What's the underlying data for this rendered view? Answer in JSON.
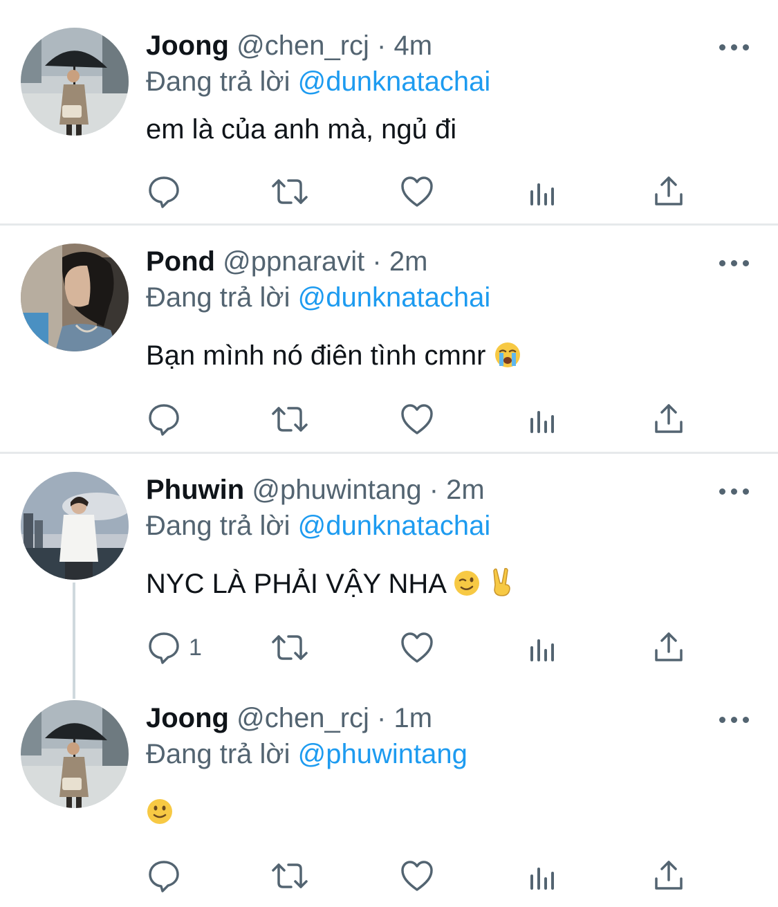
{
  "tweets": [
    {
      "name": "Joong",
      "handle": "@chen_rcj",
      "time": "4m",
      "reply_prefix": "Đang trả lời",
      "reply_to": "@dunknatachai",
      "text": "em là của anh mà, ngủ đi",
      "reply_count": "",
      "avatar_icon": "avatar-man-with-umbrella"
    },
    {
      "name": "Pond",
      "handle": "@ppnaravit",
      "time": "2m",
      "reply_prefix": "Đang trả lời",
      "reply_to": "@dunknatachai",
      "text": "Bạn mình nó điên tình cmnr",
      "emojis": [
        "loudly-crying-face"
      ],
      "reply_count": "",
      "avatar_icon": "avatar-side-profile"
    },
    {
      "name": "Phuwin",
      "handle": "@phuwintang",
      "time": "2m",
      "reply_prefix": "Đang trả lời",
      "reply_to": "@dunknatachai",
      "text": "NYC LÀ PHẢI VẬY NHA",
      "emojis": [
        "winking-face",
        "victory-hand"
      ],
      "reply_count": "1",
      "avatar_icon": "avatar-city-sky"
    },
    {
      "name": "Joong",
      "handle": "@chen_rcj",
      "time": "1m",
      "reply_prefix": "Đang trả lời",
      "reply_to": "@phuwintang",
      "text": "",
      "emojis": [
        "slightly-smiling-face"
      ],
      "reply_count": "",
      "avatar_icon": "avatar-man-with-umbrella"
    }
  ],
  "separator": "·",
  "action_icons": [
    "reply-icon",
    "retweet-icon",
    "like-icon",
    "analytics-icon",
    "share-icon"
  ],
  "colors": {
    "mention": "#1d9bf0",
    "secondary_text": "#536471",
    "primary_text": "#0f1419",
    "divider": "#e6e9eb"
  }
}
